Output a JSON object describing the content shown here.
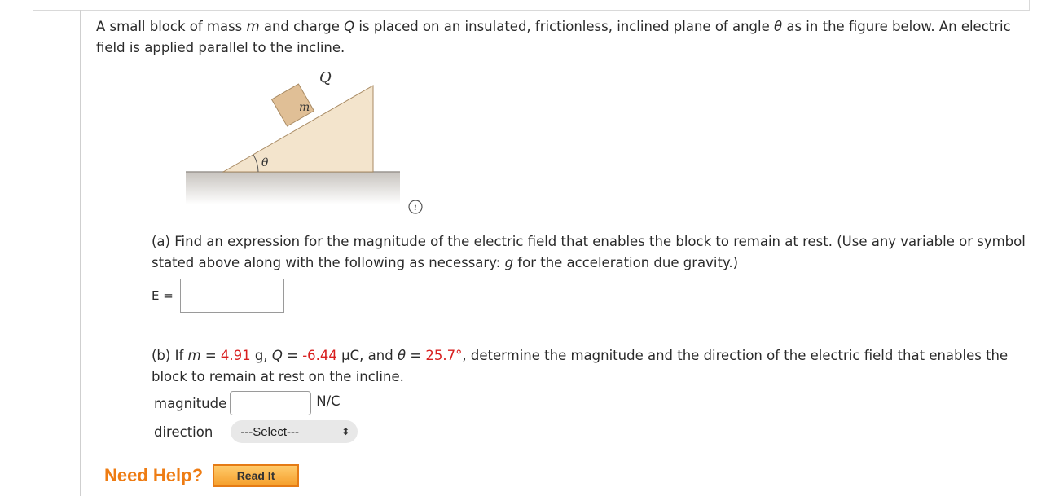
{
  "intro": {
    "part1": "A small block of mass ",
    "m": "m",
    "part2": " and charge ",
    "Q": "Q",
    "part3": " is placed on an insulated, frictionless, inclined plane of angle ",
    "theta": "θ",
    "part4": " as in the figure below. An electric field is applied parallel to the incline."
  },
  "figure": {
    "label_Q": "Q",
    "label_m": "m",
    "label_theta": "θ"
  },
  "icons": {
    "info": "info-icon"
  },
  "part_a": {
    "text1": "(a) Find an expression for the magnitude of the electric field that enables the block to remain at rest. (Use any variable or symbol stated above along with the following as necessary: ",
    "g": "g",
    "text2": " for the acceleration due gravity.)",
    "label": "E =",
    "value": ""
  },
  "part_b": {
    "t1": "(b) If ",
    "m": "m",
    "t2": " = ",
    "m_val": "4.91",
    "t3": " g, ",
    "Q": "Q",
    "t4": " = ",
    "Q_val": "-6.44",
    "t5": " µC, and ",
    "theta": "θ",
    "t6": " = ",
    "theta_val": "25.7°",
    "t7": ", determine the magnitude and the direction of the electric field that enables the block to remain at rest on the incline.",
    "magnitude_label": "magnitude",
    "magnitude_value": "",
    "unit": "N/C",
    "direction_label": "direction",
    "direction_selected": "---Select---"
  },
  "help": {
    "label": "Need Help?",
    "button": "Read It"
  },
  "colors": {
    "highlight": "#d81f1f",
    "help": "#ee7c13",
    "incline": "#f3e4cc",
    "block": "#e0bf96"
  }
}
